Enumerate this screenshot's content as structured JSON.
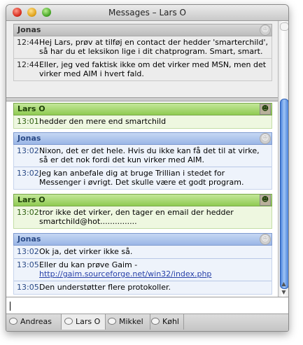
{
  "window": {
    "title": "Messages – Lars O"
  },
  "history": {
    "sender": "Jonas",
    "messages": [
      {
        "time": "12:44",
        "text": "Hej Lars, prøv at tilføj en contact der hedder 'smarterchild', så har du et leksikon lige i dit chatprogram. Smart, smart."
      },
      {
        "time": "12:44",
        "text": "Eller, jeg ved faktisk ikke om det virker med MSN, men det virker med AIM i hvert fald."
      }
    ]
  },
  "conversation": [
    {
      "sender": "Lars O",
      "messages": [
        {
          "time": "13:01",
          "text": "hedder den mere end smartchild"
        }
      ]
    },
    {
      "sender": "Jonas",
      "messages": [
        {
          "time": "13:02",
          "text": "Nixon, det er det hele. Hvis du ikke kan få det til at virke, så er det nok fordi det kun virker med AIM."
        },
        {
          "time": "13:02",
          "text": "Jeg kan anbefale dig at bruge Trillian i stedet for Messenger i øvrigt. Det skulle være et godt program."
        }
      ]
    },
    {
      "sender": "Lars O",
      "messages": [
        {
          "time": "13:02",
          "text": "tror ikke det virker, den tager en email der hedder smartchild@hot..............."
        }
      ]
    },
    {
      "sender": "Jonas",
      "messages": [
        {
          "time": "13:02",
          "text": "Ok ja, det virker ikke så."
        },
        {
          "time": "13:05",
          "text": "Eller du kan prøve Gaim -",
          "link": "http://gaim.sourceforge.net/win32/index.php"
        },
        {
          "time": "13:05",
          "text": "Den understøtter flere protokoller."
        }
      ]
    }
  ],
  "input": {
    "value": ""
  },
  "tabs": [
    {
      "label": "Andreas"
    },
    {
      "label": "Lars O",
      "active": true
    },
    {
      "label": "Mikkel"
    },
    {
      "label": "Køhl"
    }
  ],
  "colors": {
    "green_header": "#8fcb52",
    "blue_header": "#9ab6e6",
    "link": "#2740a8"
  }
}
